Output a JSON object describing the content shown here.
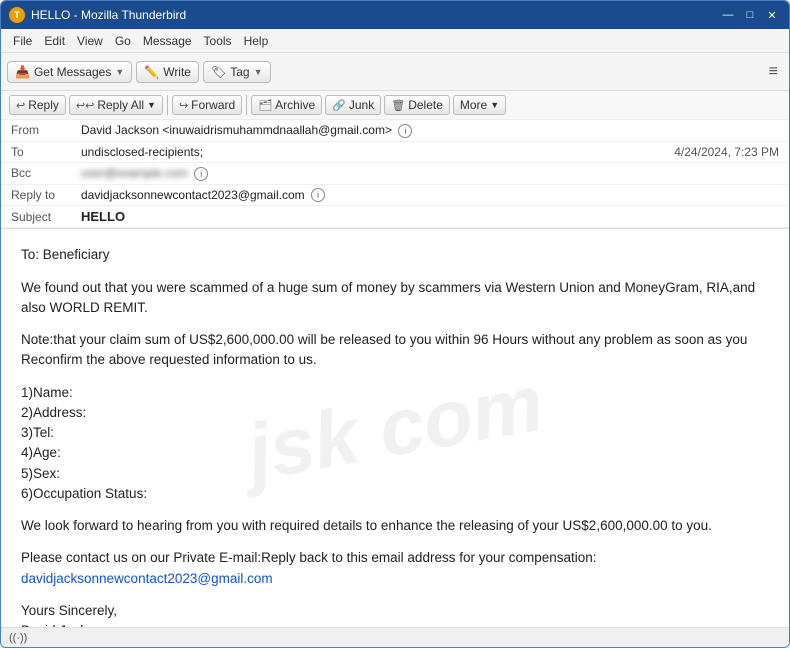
{
  "window": {
    "title": "HELLO - Mozilla Thunderbird",
    "icon": "T"
  },
  "menu": {
    "items": [
      "File",
      "Edit",
      "View",
      "Go",
      "Message",
      "Tools",
      "Help"
    ]
  },
  "toolbar": {
    "get_messages": "Get Messages",
    "write": "Write",
    "tag": "Tag",
    "hamburger": "≡"
  },
  "email_toolbar": {
    "reply": "Reply",
    "reply_all": "Reply All",
    "forward": "Forward",
    "archive": "Archive",
    "junk": "Junk",
    "delete": "Delete",
    "more": "More"
  },
  "email_header": {
    "from_label": "From",
    "from_value": "David Jackson <inuwaidrismuhammdnaallah@gmail.com>",
    "to_label": "To",
    "to_value": "undisclosed-recipients;",
    "bcc_label": "Bcc",
    "bcc_value": "[redacted]",
    "reply_to_label": "Reply to",
    "reply_to_value": "davidjacksonnewcontact2023@gmail.com",
    "subject_label": "Subject",
    "subject_value": "HELLO",
    "date": "4/24/2024, 7:23 PM"
  },
  "email_body": {
    "greeting": "To: Beneficiary",
    "para1": "We found out that you were scammed of a huge sum of money by scammers via Western Union and MoneyGram, RIA,and also WORLD REMIT.",
    "para2": "Note:that your claim sum of US$2,600,000.00 will be released to you within 96 Hours without any problem as soon as you Reconfirm the above requested information to us.",
    "list": [
      "1)Name:",
      "2)Address:",
      "3)Tel:",
      "4)Age:",
      "5)Sex:",
      "6)Occupation Status:"
    ],
    "para3": "We look forward to hearing from you with required details to enhance the releasing of your US$2,600,000.00 to you.",
    "para4": "Please contact us on our Private E-mail:Reply back to this email address  for your compensation:",
    "link": "davidjacksonnewcontact2023@gmail.com",
    "closing1": "Yours Sincerely,",
    "closing2": "David Jackson"
  },
  "status_bar": {
    "icon": "((·))",
    "text": ""
  },
  "colors": {
    "title_bar_bg": "#1a4b8c",
    "accent": "#1155cc"
  }
}
